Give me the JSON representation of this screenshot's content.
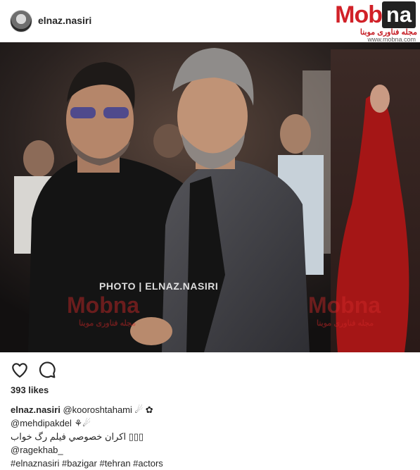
{
  "header": {
    "username": "elnaz.nasiri",
    "logo": {
      "word": "Mob",
      "box": "na",
      "subtitle": "مجله فناوری موبنا",
      "url": "www.mobna.com"
    }
  },
  "photo": {
    "credit": "PHOTO | ELNAZ.NASIRI",
    "watermark_left": "Mobna",
    "watermark_left_sub": "مجله فناوری موبنا",
    "watermark_right": "Mobna",
    "watermark_right_sub": "مجله فناوری موبنا"
  },
  "actions": {
    "like_icon": "heart-icon",
    "comment_icon": "comment-icon"
  },
  "likes": "393 likes",
  "caption": {
    "username": "elnaz.nasiri",
    "mention1": "@kooroshtahami",
    "emoji1": "☄ ✿",
    "mention2": "@mehdipakdel",
    "emoji2": "⚘☄",
    "persian_line": "اکران خصوصي فيلم رگ خواب",
    "boxes": "▯▯▯",
    "mention3": "@ragekhab_",
    "hashtags": "#elnaznasiri #bazigar #tehran #actors"
  },
  "colors": {
    "brand_red": "#d12128",
    "text": "#262626"
  }
}
